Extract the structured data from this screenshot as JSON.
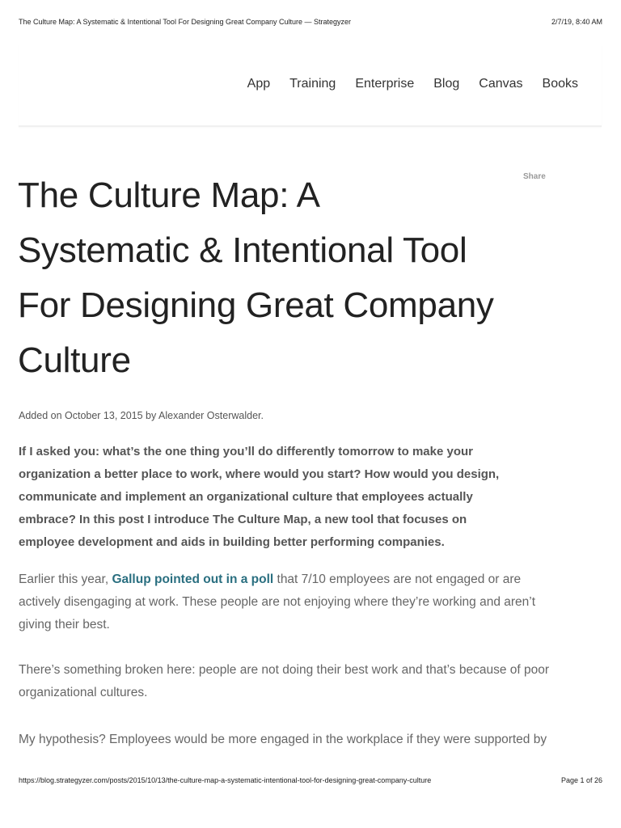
{
  "print_header": {
    "title": "The Culture Map: A Systematic & Intentional Tool For Designing Great Company Culture — Strategyzer",
    "datetime": "2/7/19, 8:40 AM"
  },
  "nav": {
    "items": [
      "App",
      "Training",
      "Enterprise",
      "Blog",
      "Canvas",
      "Books"
    ]
  },
  "share_label": "Share",
  "article": {
    "title_lines": [
      "The Culture Map: A",
      "Systematic & Intentional Tool",
      "For Designing Great Company",
      "Culture"
    ],
    "meta": "Added on October 13, 2015 by Alexander Osterwalder.",
    "intro_lines": [
      "If I asked you: what’s the one thing you’ll do differently tomorrow to make your",
      "organization a better place to work, where would you start? How would you design,",
      "communicate and implement an organizational culture that employees actually",
      "embrace? In this post I introduce The Culture Map, a new tool that focuses on",
      "employee development and aids in building better performing companies."
    ],
    "p1": {
      "before": "Earlier this year, ",
      "link": "Gallup pointed out in a poll",
      "after": " that 7/10 employees are not engaged or are",
      "lines": [
        "actively disengaging at work. These people are not enjoying where they’re working and aren’t",
        "giving their best."
      ]
    },
    "p2_lines": [
      "There’s something broken here: people are not doing their best work and that’s because of poor",
      "organizational cultures."
    ],
    "p3_lines": [
      "My hypothesis? Employees would be more engaged in the workplace if they were supported by"
    ]
  },
  "print_footer": {
    "url": "https://blog.strategyzer.com/posts/2015/10/13/the-culture-map-a-systematic-intentional-tool-for-designing-great-company-culture",
    "page": "Page 1 of 26"
  }
}
